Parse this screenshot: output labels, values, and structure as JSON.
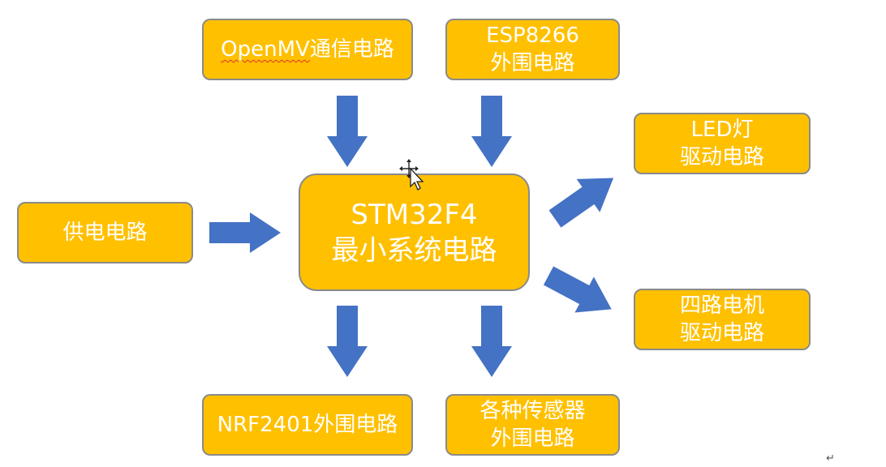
{
  "diagram": {
    "center": {
      "line1": "STM32F4",
      "line2": "最小系统电路"
    },
    "openmv": {
      "latin": "OpenMV",
      "rest": "通信电路"
    },
    "esp8266": {
      "line1": "ESP8266",
      "line2": "外围电路"
    },
    "led": {
      "line1": "LED灯",
      "line2": "驱动电路"
    },
    "power": {
      "line1": "供电电路"
    },
    "motor": {
      "line1": "四路电机",
      "line2": "驱动电路"
    },
    "nrf": {
      "line1": "NRF2401外围电路"
    },
    "sensors": {
      "line1": "各种传感器",
      "line2": "外围电路"
    }
  },
  "colors": {
    "box_fill": "#ffc000",
    "box_text": "#ffffff",
    "arrow": "#4472c4"
  },
  "icons": {
    "cursor": "move-cursor-icon",
    "corner": "return-mark-icon"
  },
  "corner_mark": "↵"
}
